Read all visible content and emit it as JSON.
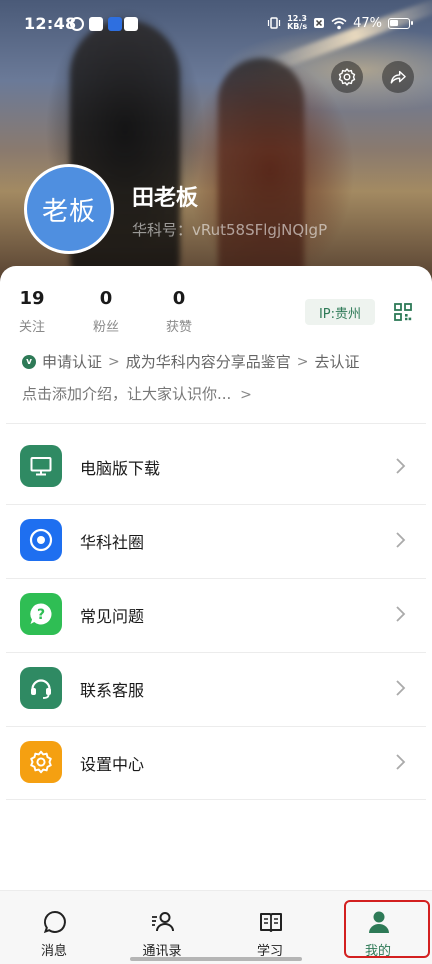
{
  "status_bar": {
    "time": "12:48",
    "speed_top": "12.3",
    "speed_bottom": "KB/s",
    "battery": "47%"
  },
  "profile": {
    "avatar_text": "老板",
    "name": "田老板",
    "id_line": "华科号：vRut58SFlgjNQIgP",
    "avatar_color": "#4f8fe0"
  },
  "stats": [
    {
      "value": "19",
      "label": "关注"
    },
    {
      "value": "0",
      "label": "粉丝"
    },
    {
      "value": "0",
      "label": "获赞"
    }
  ],
  "ip_badge": "IP:贵州",
  "certification": {
    "badge": "v",
    "apply": "申请认证",
    "become": "成为华科内容分享品鉴官",
    "go": "去认证"
  },
  "intro_prompt": "点击添加介绍，让大家认识你...",
  "menu": [
    {
      "label": "电脑版下载",
      "icon": "monitor-icon",
      "color": "#2f8a63"
    },
    {
      "label": "华科社圈",
      "icon": "target-circle-icon",
      "color": "#1e6ff0"
    },
    {
      "label": "常见问题",
      "icon": "question-bubble-icon",
      "color": "#2fbe54"
    },
    {
      "label": "联系客服",
      "icon": "headset-icon",
      "color": "#2f8a63"
    },
    {
      "label": "设置中心",
      "icon": "gear-icon",
      "color": "#f5a011"
    }
  ],
  "bottom_nav": [
    {
      "label": "消息",
      "icon": "chat-bubble-icon"
    },
    {
      "label": "通讯录",
      "icon": "contacts-icon"
    },
    {
      "label": "学习",
      "icon": "book-icon"
    },
    {
      "label": "我的",
      "icon": "person-icon",
      "active": true
    }
  ],
  "colors": {
    "accent": "#2e7a57",
    "highlight_box": "#d32020"
  }
}
